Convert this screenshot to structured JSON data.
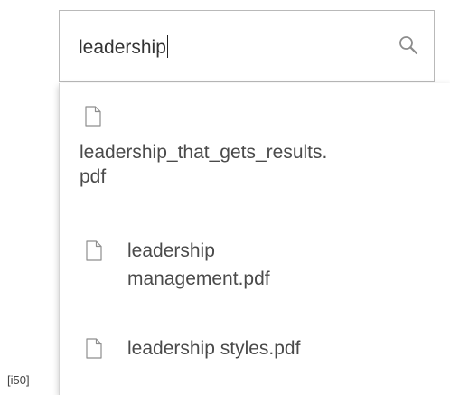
{
  "search": {
    "value": "leadership",
    "icon": "search-icon"
  },
  "results": [
    {
      "label": "leadership_that_gets_results.\npdf",
      "icon": "file-icon"
    },
    {
      "label": "leadership\nmanagement.pdf",
      "icon": "file-icon"
    },
    {
      "label": "leadership styles.pdf",
      "icon": "file-icon"
    }
  ],
  "corner_tag": "[i50]"
}
